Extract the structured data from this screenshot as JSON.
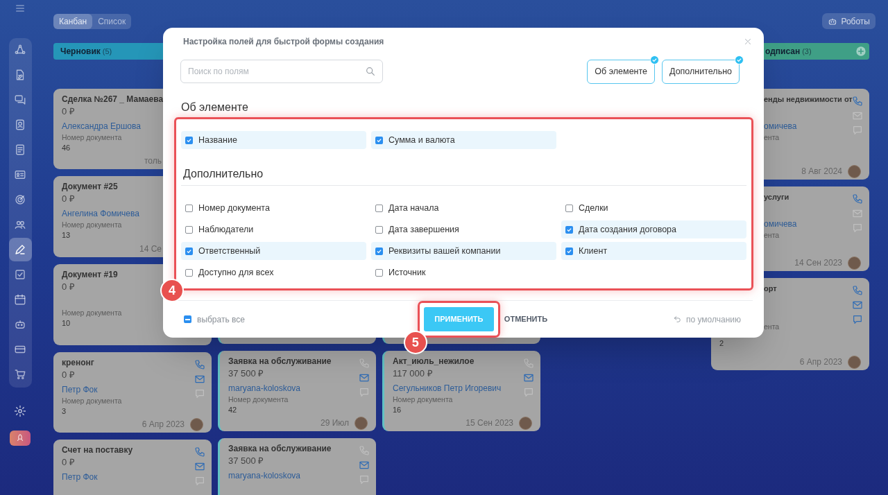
{
  "sidebar": {
    "items": [
      {
        "kind": "cycle",
        "selected": false
      },
      {
        "kind": "doc-edit",
        "selected": false
      },
      {
        "kind": "chat",
        "selected": false
      },
      {
        "kind": "contact",
        "selected": false
      },
      {
        "kind": "doc",
        "selected": false
      },
      {
        "kind": "idcard",
        "selected": false
      },
      {
        "kind": "target",
        "selected": false
      },
      {
        "kind": "people",
        "selected": false
      },
      {
        "kind": "pen",
        "selected": true
      },
      {
        "kind": "check",
        "selected": false
      },
      {
        "kind": "calendar",
        "selected": false
      },
      {
        "kind": "robot",
        "selected": false
      },
      {
        "kind": "card",
        "selected": false
      },
      {
        "kind": "cart",
        "selected": false
      }
    ]
  },
  "view_tabs": [
    {
      "label": "Канбан",
      "selected": true
    },
    {
      "label": "Список",
      "selected": false
    }
  ],
  "robots_button": {
    "label": "Роботы"
  },
  "columns": [
    {
      "title": "Черновик",
      "count": "(5)",
      "color": "#2596b8",
      "cards": [
        {
          "title": "Сделка №267 _ Мамаева",
          "amount": "0 ₽",
          "person": "Александра Ершова",
          "label": "Номер документа",
          "number": "46",
          "date": "толь"
        },
        {
          "title": "Документ #25",
          "amount": "0 ₽",
          "person": "Ангелина Фомичева",
          "label": "Номер документа",
          "number": "13",
          "date": "14 Се"
        },
        {
          "title": "Документ #19",
          "amount": "0 ₽",
          "label": "Номер документа",
          "number": "10"
        },
        {
          "title": "кренонг",
          "amount": "0 ₽",
          "person": "Петр Фок",
          "label": "Номер документа",
          "number": "3",
          "date": "6 Апр 2023",
          "avatar": true,
          "icons": [
            {
              "kind": "phone",
              "active": true
            },
            {
              "kind": "mail",
              "active": true
            },
            {
              "kind": "chat",
              "active": false
            }
          ]
        },
        {
          "title": "Счет на поставку",
          "amount": "0 ₽",
          "person": "Петр Фок",
          "icons": [
            {
              "kind": "phone",
              "active": true
            },
            {
              "kind": "mail",
              "active": true
            },
            {
              "kind": "chat",
              "active": false
            }
          ]
        }
      ]
    },
    {
      "cards": [
        {
          "title": "Заявка на обслуживание",
          "amount": "37 500 ₽",
          "person": "maryana-koloskova",
          "label": "Номер документа",
          "number": "42",
          "date": "29 Июл",
          "avatar": true,
          "icons": [
            {
              "kind": "phone",
              "active": false
            },
            {
              "kind": "mail",
              "active": true
            },
            {
              "kind": "chat",
              "active": false
            }
          ]
        },
        {
          "title": "Заявка на обслуживание",
          "amount": "37 500 ₽",
          "person": "maryana-koloskova",
          "icons": [
            {
              "kind": "phone",
              "active": false
            },
            {
              "kind": "mail",
              "active": true
            },
            {
              "kind": "chat",
              "active": false
            }
          ]
        }
      ]
    },
    {
      "cards": [
        {
          "title": "Акт_июль_нежилое",
          "amount": "117 000 ₽",
          "person": "Сегульников Петр Игоревич",
          "label": "Номер документа",
          "number": "16",
          "date": "15 Сен 2023",
          "avatar": true,
          "icons": [
            {
              "kind": "phone",
              "active": false
            },
            {
              "kind": "mail",
              "active": true
            },
            {
              "kind": "chat",
              "active": false
            }
          ]
        }
      ]
    },
    {},
    {
      "title": "одписан",
      "count": "(3)",
      "color": "#3f9f86",
      "cards": [
        {
          "title": "енды недвижимости от",
          "person": "омичева",
          "label": "ента",
          "date": "8 Авг 2024",
          "avatar": true,
          "icons": [
            {
              "kind": "phone",
              "active": true
            },
            {
              "kind": "mail",
              "active": false
            },
            {
              "kind": "chat",
              "active": false
            }
          ]
        },
        {
          "title": "услуги",
          "person": "омичева",
          "label": "ента",
          "date": "14 Сен 2023",
          "avatar": true,
          "icons": [
            {
              "kind": "phone",
              "active": true
            },
            {
              "kind": "mail",
              "active": false
            },
            {
              "kind": "chat",
              "active": false
            }
          ]
        },
        {
          "title": "орт",
          "label": "ента",
          "number": "2",
          "date": "6 Апр 2023",
          "avatar": true,
          "icons": [
            {
              "kind": "phone",
              "active": true
            },
            {
              "kind": "mail",
              "active": true
            },
            {
              "kind": "chat",
              "active": true
            }
          ]
        }
      ]
    }
  ],
  "dialog": {
    "title": "Настройка полей для быстрой формы создания",
    "search": {
      "placeholder": "Поиск по полям"
    },
    "filters": [
      {
        "label": "Об элементе",
        "selected": true
      },
      {
        "label": "Дополнительно",
        "selected": true
      }
    ],
    "sections": [
      {
        "title": "Об элементе",
        "fields": [
          {
            "label": "Название",
            "checked": true
          },
          {
            "label": "Сумма и валюта",
            "checked": true
          }
        ]
      },
      {
        "title": "Дополнительно",
        "fields": [
          {
            "label": "Номер документа",
            "checked": false
          },
          {
            "label": "Дата начала",
            "checked": false
          },
          {
            "label": "Сделки",
            "checked": false
          },
          {
            "label": "Наблюдатели",
            "checked": false
          },
          {
            "label": "Дата завершения",
            "checked": false
          },
          {
            "label": "Дата создания договора",
            "checked": true
          },
          {
            "label": "Ответственный",
            "checked": true
          },
          {
            "label": "Реквизиты вашей компании",
            "checked": true
          },
          {
            "label": "Клиент",
            "checked": true
          },
          {
            "label": "Доступно для всех",
            "checked": false
          },
          {
            "label": "Источник",
            "checked": false
          }
        ]
      }
    ],
    "select_all": {
      "label": "выбрать все",
      "indeterminate": true
    },
    "apply": "ПРИМЕНИТЬ",
    "cancel": "ОТМЕНИТЬ",
    "reset": "по умолчанию"
  },
  "annotations": [
    {
      "label": "4"
    },
    {
      "label": "5"
    }
  ]
}
